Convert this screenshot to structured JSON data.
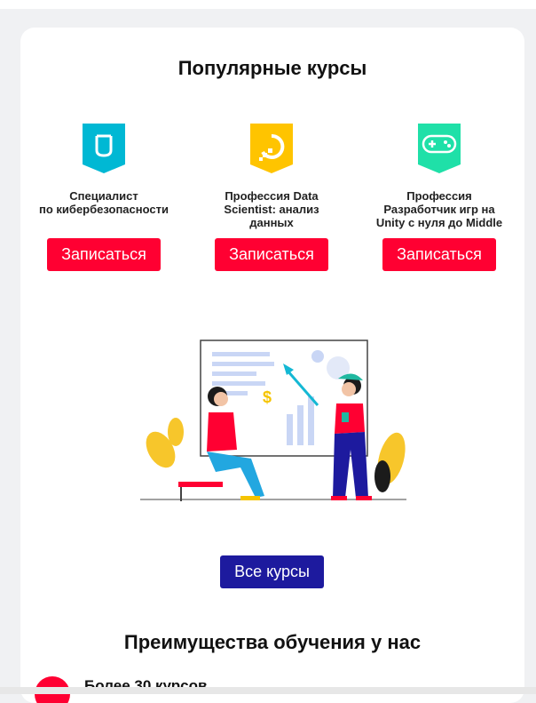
{
  "popular": {
    "title": "Популярные курсы",
    "courses": [
      {
        "name": "Специалист\nпо кибербезопасности",
        "button": "Записаться",
        "icon": "shield-icon",
        "color": "#00b8d4"
      },
      {
        "name": "Профессия Data\nScientist: анализ\nданных",
        "button": "Записаться",
        "icon": "data-logo-icon",
        "color": "#ffc400"
      },
      {
        "name": "Профессия\nРазработчик игр на\nUnity с нуля до Middle",
        "button": "Записаться",
        "icon": "gamepad-icon",
        "color": "#1fe0a8"
      }
    ],
    "all_courses_button": "Все курсы"
  },
  "advantages": {
    "title": "Преимущества обучения у нас",
    "items": [
      {
        "text": "Более 30 курсов"
      }
    ]
  },
  "colors": {
    "accent_red": "#ff0032",
    "accent_blue": "#1d1a9e",
    "background": "#f0f1f3"
  }
}
